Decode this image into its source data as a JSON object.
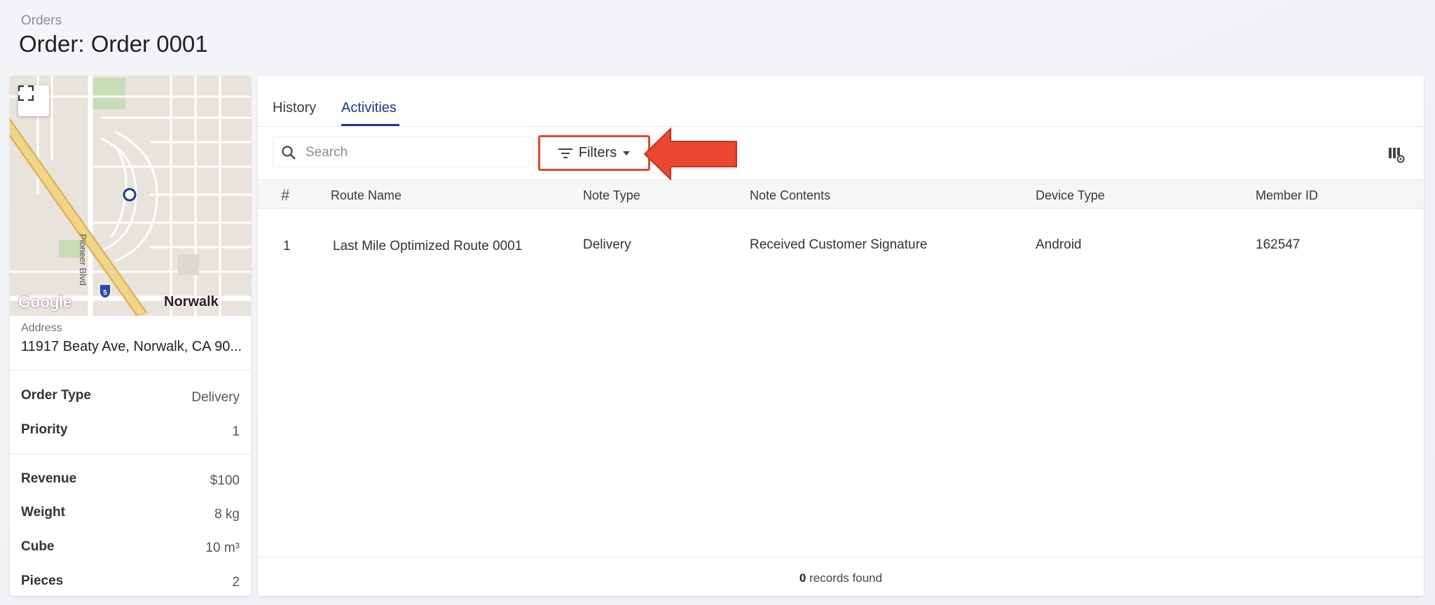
{
  "header": {
    "breadcrumb": "Orders",
    "title": "Order: Order 0001"
  },
  "map": {
    "city_label": "Norwalk",
    "street_label": "Pioneer Blvd",
    "attribution": "Google",
    "highway_shield": "5"
  },
  "order_details": {
    "address_label": "Address",
    "address_value": "11917 Beaty Ave, Norwalk, CA 90...",
    "fields": [
      {
        "label": "Order Type",
        "value": "Delivery"
      },
      {
        "label": "Priority",
        "value": "1"
      },
      {
        "label": "Revenue",
        "value": "$100"
      },
      {
        "label": "Weight",
        "value": "8 kg"
      },
      {
        "label": "Cube",
        "value": "10 m³"
      },
      {
        "label": "Pieces",
        "value": "2"
      }
    ]
  },
  "tabs": [
    {
      "label": "History",
      "active": false
    },
    {
      "label": "Activities",
      "active": true
    }
  ],
  "toolbar": {
    "search_placeholder": "Search",
    "filters_label": "Filters"
  },
  "table": {
    "columns": [
      "#",
      "Route Name",
      "Note Type",
      "Note Contents",
      "Device Type",
      "Member ID"
    ],
    "rows": [
      {
        "num": "1",
        "route_name": "Last Mile Optimized Route 0001",
        "note_type": "Delivery",
        "note_contents": "Received Customer Signature",
        "device_type": "Android",
        "member_id": "162547"
      }
    ]
  },
  "footer": {
    "records_count": "0",
    "records_text": "records found"
  },
  "colors": {
    "accent": "#1a3a8f",
    "highlight": "#e8452f"
  }
}
